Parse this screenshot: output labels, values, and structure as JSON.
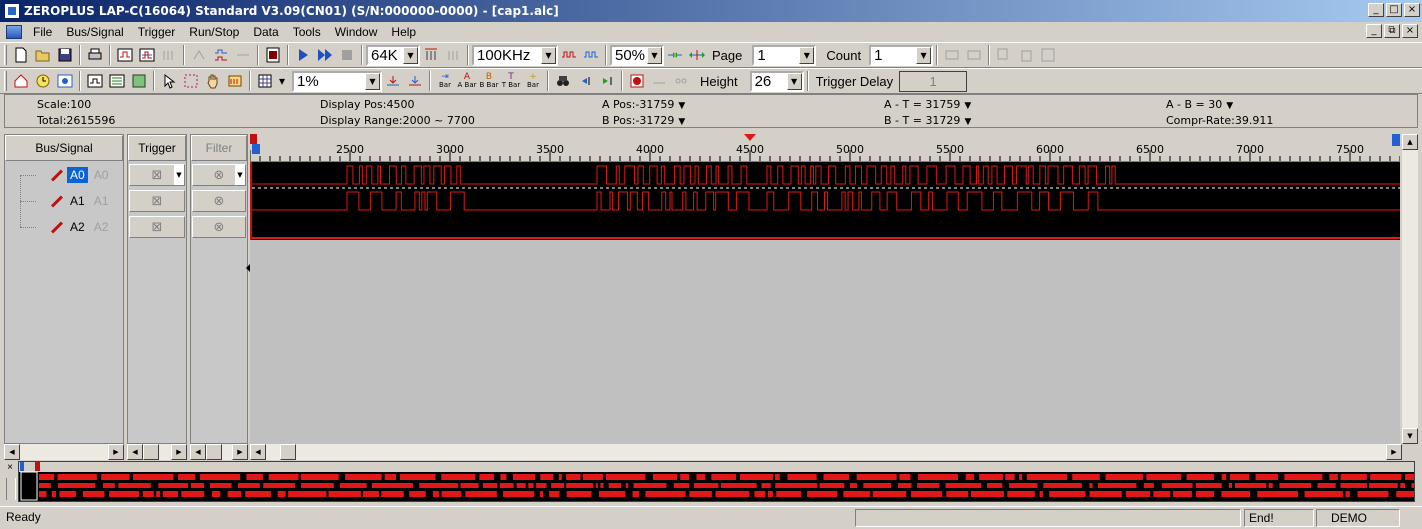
{
  "window": {
    "title": "ZEROPLUS LAP-C(16064) Standard V3.09(CN01) (S/N:000000-0000) - [cap1.alc]",
    "caption_buttons": [
      "_",
      "□",
      "×"
    ],
    "mdi_buttons": [
      "_",
      "⧉",
      "×"
    ]
  },
  "menu": {
    "items": [
      {
        "label": "File"
      },
      {
        "label": "Bus/Signal"
      },
      {
        "label": "Trigger"
      },
      {
        "label": "Run/Stop"
      },
      {
        "label": "Data"
      },
      {
        "label": "Tools"
      },
      {
        "label": "Window"
      },
      {
        "label": "Help"
      }
    ]
  },
  "toolbar1": {
    "memory_depth": "64K",
    "sample_rate": "100KHz",
    "trigger_position": "50%",
    "page_label": "Page",
    "page_value": "1",
    "count_label": "Count",
    "count_value": "1"
  },
  "toolbar2": {
    "zoom_value": "1%",
    "height_label": "Height",
    "height_value": "26",
    "trigger_delay_label": "Trigger Delay",
    "trigger_delay_value": "1",
    "bar_buttons": [
      "Bar",
      "A Bar",
      "B Bar",
      "T Bar",
      "Bar"
    ]
  },
  "info": {
    "scale": "Scale:100",
    "total": "Total:2615596",
    "display_pos": "Display Pos:4500",
    "display_range": "Display Range:2000 ~ 7700",
    "a_pos": "A Pos:-31759",
    "b_pos": "B Pos:-31729",
    "a_minus_t": "A - T = 31759",
    "b_minus_t": "B - T = 31729",
    "a_minus_b": "A - B = 30",
    "compr_rate": "Compr-Rate:39.911"
  },
  "columns": {
    "bus_signal": "Bus/Signal",
    "trigger": "Trigger",
    "filter": "Filter"
  },
  "signals": [
    {
      "name": "A0",
      "alias": "A0",
      "color": "#c01010"
    },
    {
      "name": "A1",
      "alias": "A1",
      "color": "#e01818"
    },
    {
      "name": "A2",
      "alias": "A2",
      "color": "#d05020"
    }
  ],
  "ruler": {
    "ticks": [
      "2500",
      "3000",
      "3500",
      "4000",
      "4500",
      "5000",
      "5500",
      "6000",
      "6500",
      "7000",
      "7500"
    ],
    "range_start": 2000,
    "range_end": 7750
  },
  "colors": {
    "wave_bg": "#000000",
    "trace": "#e01818",
    "trigger_marker": "#e01818",
    "cursor_marker": "#2060d0"
  },
  "status": {
    "ready": "Ready",
    "end": "End!",
    "mode": "DEMO"
  }
}
